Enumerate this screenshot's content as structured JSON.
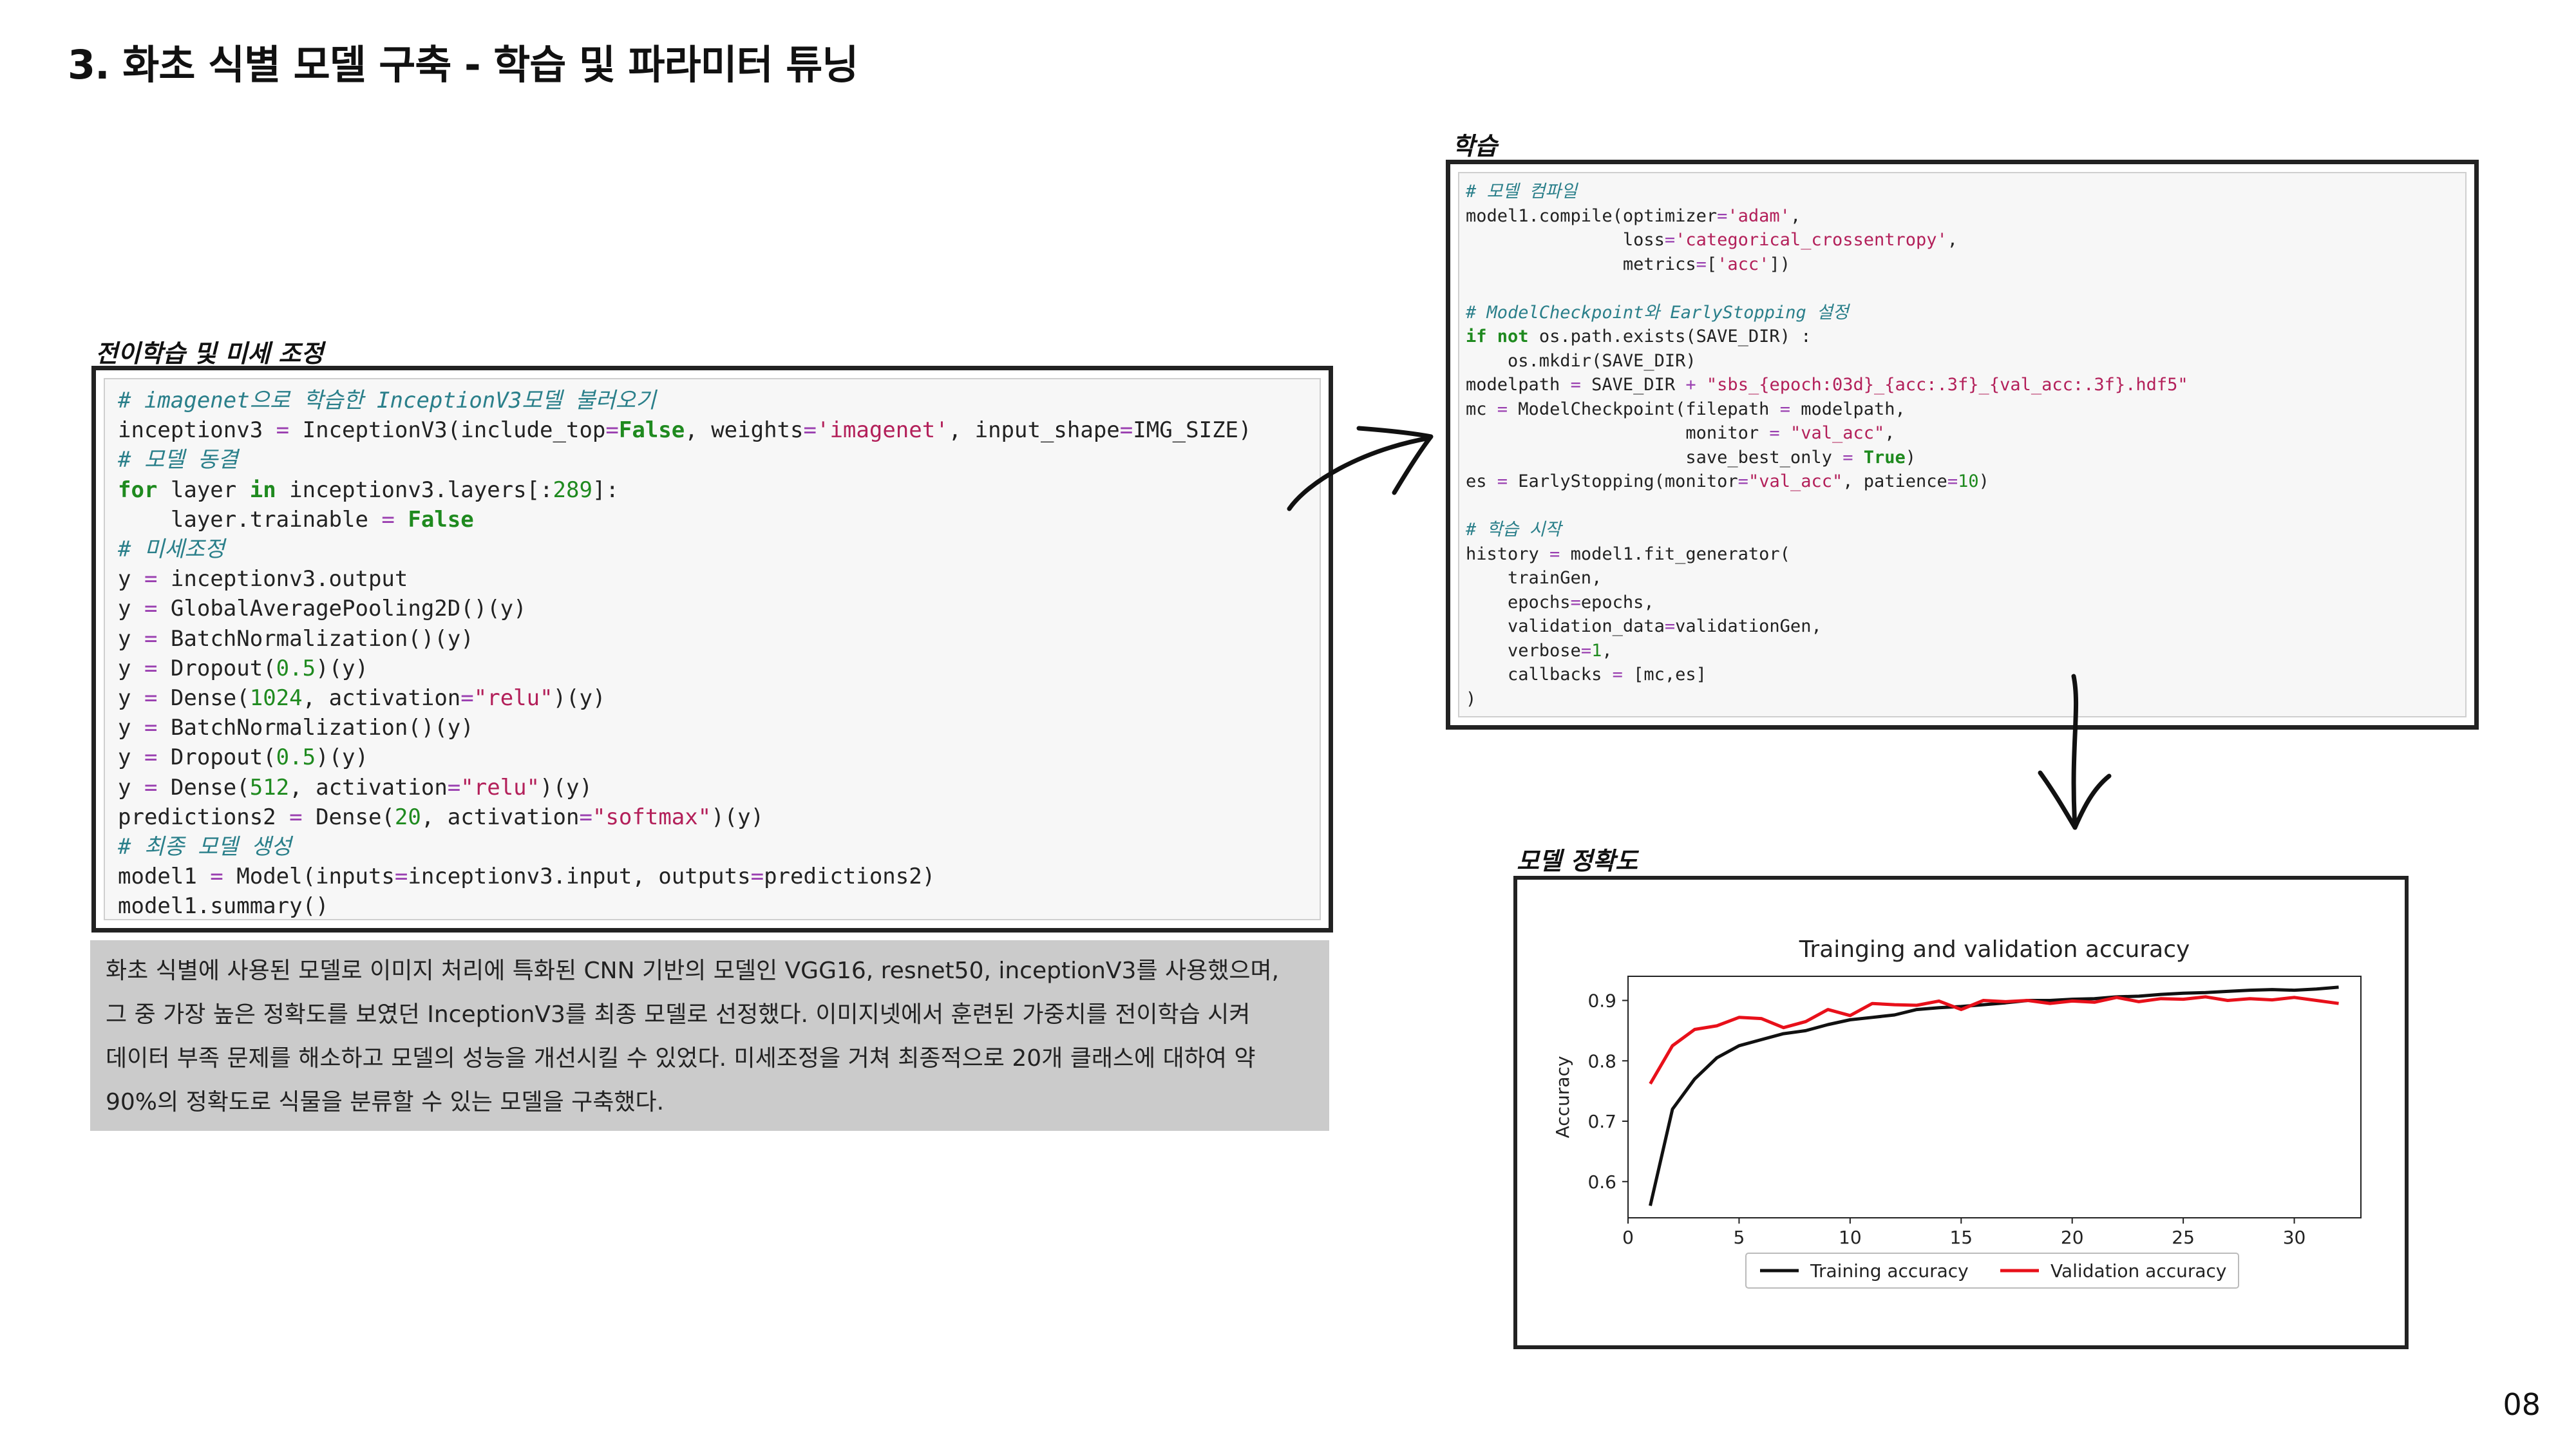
{
  "page": {
    "title": "3. 화초 식별 모델 구축 - 학습 및 파라미터 튜닝",
    "page_number": "08"
  },
  "transfer_section": {
    "label": "전이학습 및 미세 조정",
    "code_lines": [
      "# imagenet으로 학습한 InceptionV3모델 불러오기",
      "inceptionv3 = InceptionV3(include_top=False, weights='imagenet', input_shape=IMG_SIZE)",
      "# 모델 동결",
      "for layer in inceptionv3.layers[:289]:",
      "    layer.trainable = False",
      "# 미세조정",
      "y = inceptionv3.output",
      "y = GlobalAveragePooling2D()(y)",
      "y = BatchNormalization()(y)",
      "y = Dropout(0.5)(y)",
      "y = Dense(1024, activation=\"relu\")(y)",
      "y = BatchNormalization()(y)",
      "y = Dropout(0.5)(y)",
      "y = Dense(512, activation=\"relu\")(y)",
      "predictions2 = Dense(20, activation=\"softmax\")(y)",
      "# 최종 모델 생성",
      "model1 = Model(inputs=inceptionv3.input, outputs=predictions2)",
      "model1.summary()"
    ]
  },
  "description": {
    "lines": [
      "화초 식별에 사용된 모델로 이미지 처리에 특화된 CNN 기반의 모델인 VGG16, resnet50, inceptionV3를 사용했으며,",
      "그 중 가장 높은 정확도를 보였던 InceptionV3를 최종 모델로 선정했다. 이미지넷에서 훈련된 가중치를 전이학습 시켜",
      "데이터 부족 문제를 해소하고 모델의 성능을 개선시킬 수 있었다. 미세조정을 거쳐 최종적으로 20개 클래스에 대하여 약",
      "90%의 정확도로 식물을 분류할 수 있는 모델을 구축했다."
    ]
  },
  "training_section": {
    "label": "학습",
    "code_lines": [
      "# 모델 컴파일",
      "model1.compile(optimizer='adam',",
      "               loss='categorical_crossentropy',",
      "               metrics=['acc'])",
      "",
      "# ModelCheckpoint와 EarlyStopping 설정",
      "if not os.path.exists(SAVE_DIR) :",
      "    os.mkdir(SAVE_DIR)",
      "modelpath = SAVE_DIR + \"sbs_{epoch:03d}_{acc:.3f}_{val_acc:.3f}.hdf5\"",
      "mc = ModelCheckpoint(filepath = modelpath,",
      "                     monitor = \"val_acc\",",
      "                     save_best_only = True)",
      "es = EarlyStopping(monitor=\"val_acc\", patience=10)",
      "",
      "# 학습 시작",
      "history = model1.fit_generator(",
      "    trainGen,",
      "    epochs=epochs,",
      "    validation_data=validationGen,",
      "    verbose=1,",
      "    callbacks = [mc,es]",
      ")"
    ]
  },
  "accuracy_section": {
    "label": "모델 정확도"
  },
  "icons": {
    "arrow_right": "hand-drawn-arrow-right-icon",
    "arrow_down": "hand-drawn-arrow-down-icon"
  },
  "chart_data": {
    "type": "line",
    "title": "Trainging and validation accuracy",
    "xlabel": "",
    "ylabel": "Accuracy",
    "xlim": [
      0,
      33
    ],
    "ylim": [
      0.54,
      0.94
    ],
    "xticks": [
      "0",
      "5",
      "10",
      "15",
      "20",
      "25",
      "30"
    ],
    "yticks": [
      "0.6",
      "0.7",
      "0.8",
      "0.9"
    ],
    "legend_position": "bottom-center",
    "grid": false,
    "x": [
      1,
      2,
      3,
      4,
      5,
      6,
      7,
      8,
      9,
      10,
      11,
      12,
      13,
      14,
      15,
      16,
      17,
      18,
      19,
      20,
      21,
      22,
      23,
      24,
      25,
      26,
      27,
      28,
      29,
      30,
      31,
      32
    ],
    "series": [
      {
        "name": "Training accuracy",
        "color": "#111111",
        "values": [
          0.56,
          0.72,
          0.77,
          0.805,
          0.825,
          0.835,
          0.845,
          0.85,
          0.86,
          0.868,
          0.872,
          0.876,
          0.885,
          0.888,
          0.89,
          0.893,
          0.896,
          0.9,
          0.9,
          0.902,
          0.903,
          0.906,
          0.907,
          0.91,
          0.912,
          0.913,
          0.915,
          0.917,
          0.918,
          0.917,
          0.919,
          0.922
        ]
      },
      {
        "name": "Validation accuracy",
        "color": "#e8101a",
        "values": [
          0.762,
          0.825,
          0.852,
          0.858,
          0.872,
          0.87,
          0.855,
          0.865,
          0.885,
          0.875,
          0.895,
          0.893,
          0.892,
          0.899,
          0.885,
          0.9,
          0.898,
          0.9,
          0.895,
          0.899,
          0.897,
          0.905,
          0.898,
          0.903,
          0.902,
          0.906,
          0.9,
          0.903,
          0.901,
          0.905,
          0.9,
          0.895
        ]
      }
    ]
  }
}
